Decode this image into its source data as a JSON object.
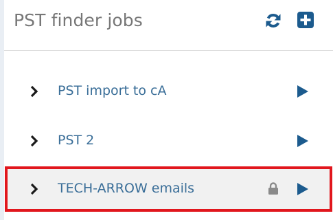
{
  "panel": {
    "title": "PST finder jobs"
  },
  "toolbar": {
    "refresh_icon": "refresh-icon",
    "add_icon": "plus-square-icon"
  },
  "jobs": [
    {
      "label": "PST import to cA",
      "locked": false,
      "selected": false
    },
    {
      "label": "PST 2",
      "locked": false,
      "selected": false
    },
    {
      "label": "TECH-ARROW emails",
      "locked": true,
      "selected": true
    }
  ],
  "colors": {
    "link": "#3a6e98",
    "accent": "#1c5b8e",
    "selection_border": "#e1161d",
    "lock": "#8a8a8a",
    "title": "#777777"
  }
}
